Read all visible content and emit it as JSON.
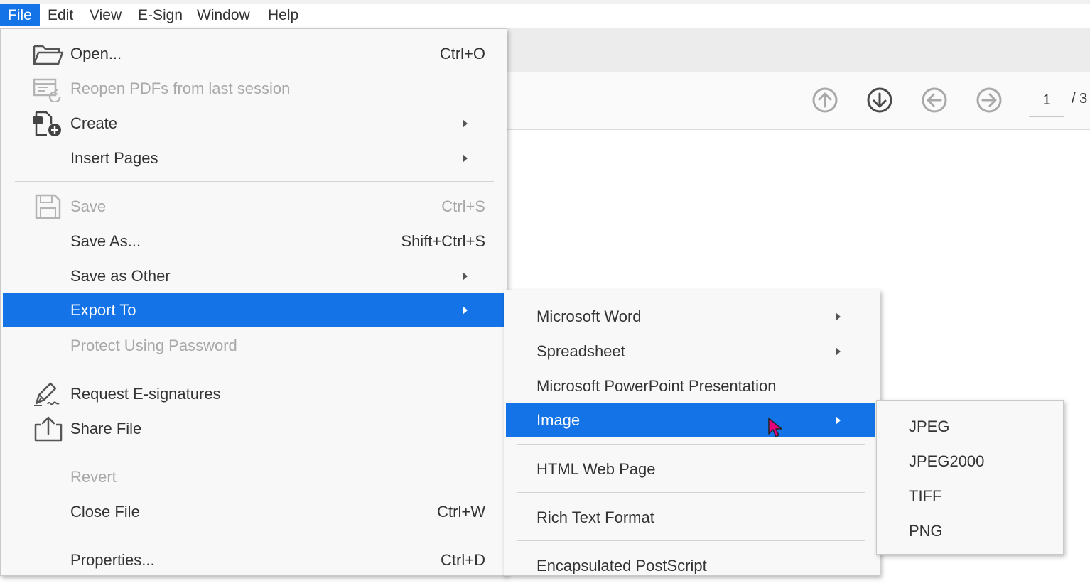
{
  "menubar": {
    "items": [
      "File",
      "Edit",
      "View",
      "E-Sign",
      "Window",
      "Help"
    ]
  },
  "toolbar": {
    "page_current": "1",
    "page_total": "/ 3"
  },
  "file_menu": {
    "open": {
      "label": "Open...",
      "shortcut": "Ctrl+O"
    },
    "reopen": {
      "label": "Reopen PDFs from last session"
    },
    "create": {
      "label": "Create"
    },
    "insert_pages": {
      "label": "Insert Pages"
    },
    "save": {
      "label": "Save",
      "shortcut": "Ctrl+S"
    },
    "save_as": {
      "label": "Save As...",
      "shortcut": "Shift+Ctrl+S"
    },
    "save_as_other": {
      "label": "Save as Other"
    },
    "export_to": {
      "label": "Export To"
    },
    "protect": {
      "label": "Protect Using Password"
    },
    "request_esign": {
      "label": "Request E-signatures"
    },
    "share_file": {
      "label": "Share File"
    },
    "revert": {
      "label": "Revert"
    },
    "close_file": {
      "label": "Close File",
      "shortcut": "Ctrl+W"
    },
    "properties": {
      "label": "Properties...",
      "shortcut": "Ctrl+D"
    }
  },
  "export_menu": {
    "items": [
      "Microsoft Word",
      "Spreadsheet",
      "Microsoft PowerPoint Presentation",
      "Image",
      "HTML Web Page",
      "Rich Text Format",
      "Encapsulated PostScript"
    ]
  },
  "image_menu": {
    "items": [
      "JPEG",
      "JPEG2000",
      "TIFF",
      "PNG"
    ]
  },
  "colors": {
    "highlight": "#1473e6",
    "menu_bg": "#f8f8f8",
    "disabled_text": "#a8a8a8",
    "cursor": "#e6007e"
  }
}
